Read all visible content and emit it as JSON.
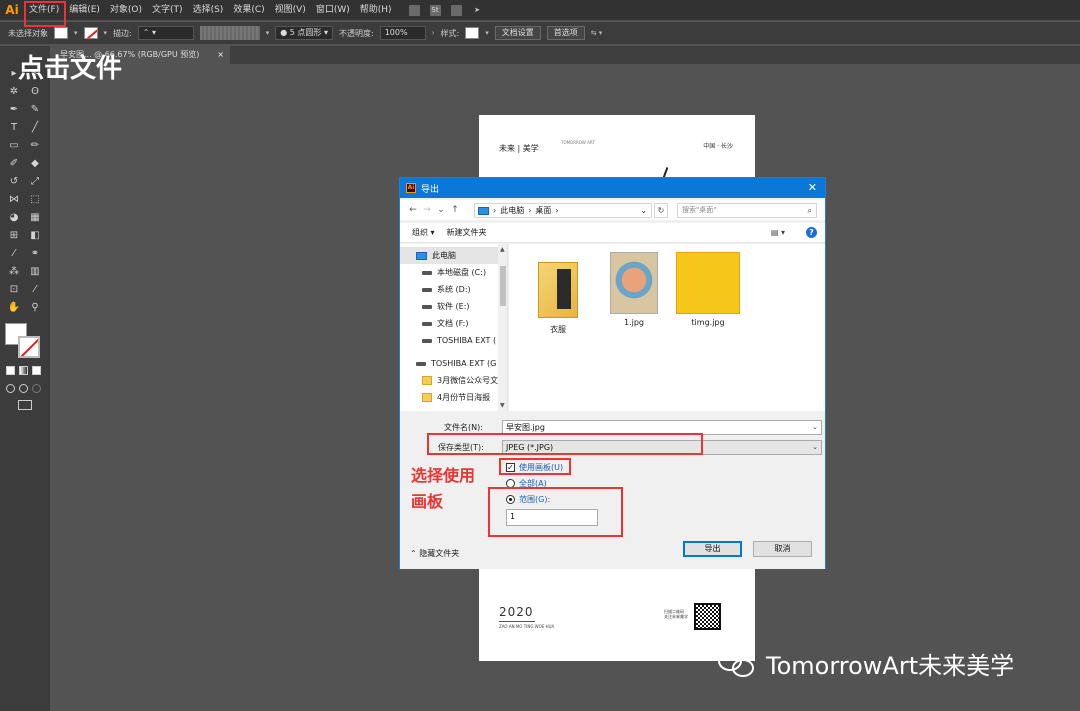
{
  "app": {
    "logo": "Ai"
  },
  "menu": {
    "items": [
      "文件(F)",
      "编辑(E)",
      "对象(O)",
      "文字(T)",
      "选择(S)",
      "效果(C)",
      "视图(V)",
      "窗口(W)",
      "帮助(H)"
    ],
    "bridge_label": "St"
  },
  "controlbar": {
    "no_selection": "未选择对象",
    "stroke_label": "描边:",
    "brush_value": "5 点圆形",
    "opacity_label": "不透明度:",
    "opacity_value": "100%",
    "style_label": "样式:",
    "doc_settings": "文档设置",
    "preferences": "首选项"
  },
  "document_tab": {
    "title": "早安图... @ 66.67% (RGB/GPU 预览)",
    "close": "×"
  },
  "annotations": {
    "click_file": "点击文件",
    "use_artboard_line1": "选择使用",
    "use_artboard_line2": "画板"
  },
  "artboard": {
    "brand": "未来 | 美学",
    "brand_sub": "TOMORROW\nART",
    "city": "中国 · 长沙",
    "year": "2020",
    "tagline": "ZAO AN MO TING WOE HUA",
    "scan_text": "扫描二维码\n关注未来美学"
  },
  "dialog": {
    "title": "导出",
    "close": "✕",
    "path": [
      "此电脑",
      "桌面"
    ],
    "search_placeholder": "搜索\"桌面\"",
    "organize": "组织 ▾",
    "new_folder": "新建文件夹",
    "nav": [
      {
        "label": "此电脑",
        "type": "pc"
      },
      {
        "label": "本地磁盘 (C:)",
        "type": "drive"
      },
      {
        "label": "系统 (D:)",
        "type": "drive"
      },
      {
        "label": "软件 (E:)",
        "type": "drive"
      },
      {
        "label": "文档 (F:)",
        "type": "drive"
      },
      {
        "label": "TOSHIBA EXT (",
        "type": "drive"
      },
      {
        "label": "TOSHIBA EXT (G",
        "type": "drive"
      },
      {
        "label": "3月微信公众号文",
        "type": "folder"
      },
      {
        "label": "4月份节日海报",
        "type": "folder"
      }
    ],
    "files": [
      {
        "name": "衣服",
        "kind": "folder"
      },
      {
        "name": "1.jpg",
        "kind": "image"
      },
      {
        "name": "timg.jpg",
        "kind": "yellow"
      }
    ],
    "filename_label": "文件名(N):",
    "filename_value": "早安图.jpg",
    "filetype_label": "保存类型(T):",
    "filetype_value": "JPEG (*.JPG)",
    "use_artboards": "使用画板(U)",
    "all": "全部(A)",
    "range": "范围(G):",
    "range_value": "1",
    "hide_folders": "隐藏文件夹",
    "export_btn": "导出",
    "cancel_btn": "取消"
  },
  "watermark": {
    "text": "TomorrowArt未来美学"
  },
  "colors": {
    "accent": "#0b77d7",
    "annotation_red": "#e33333",
    "ai_orange": "#ff9a00"
  }
}
